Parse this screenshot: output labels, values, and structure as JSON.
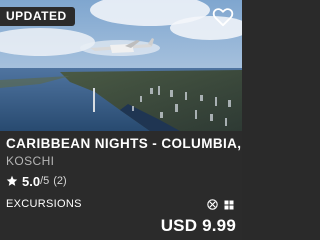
{
  "card": {
    "badge": "UPDATED",
    "title": "CARIBBEAN NIGHTS - COLUMBIA, P",
    "author": "KOSCHI",
    "rating": {
      "score": "5.0",
      "max": "/5",
      "count": "(2)"
    },
    "category": "EXCURSIONS",
    "platform_icons": [
      "xbox-icon",
      "windows-icon"
    ],
    "price": "USD 9.99",
    "favorite_icon": "heart-outline-icon",
    "colors": {
      "background": "#2b2b2b",
      "text": "#ffffff",
      "muted": "#b5b5b5"
    }
  }
}
